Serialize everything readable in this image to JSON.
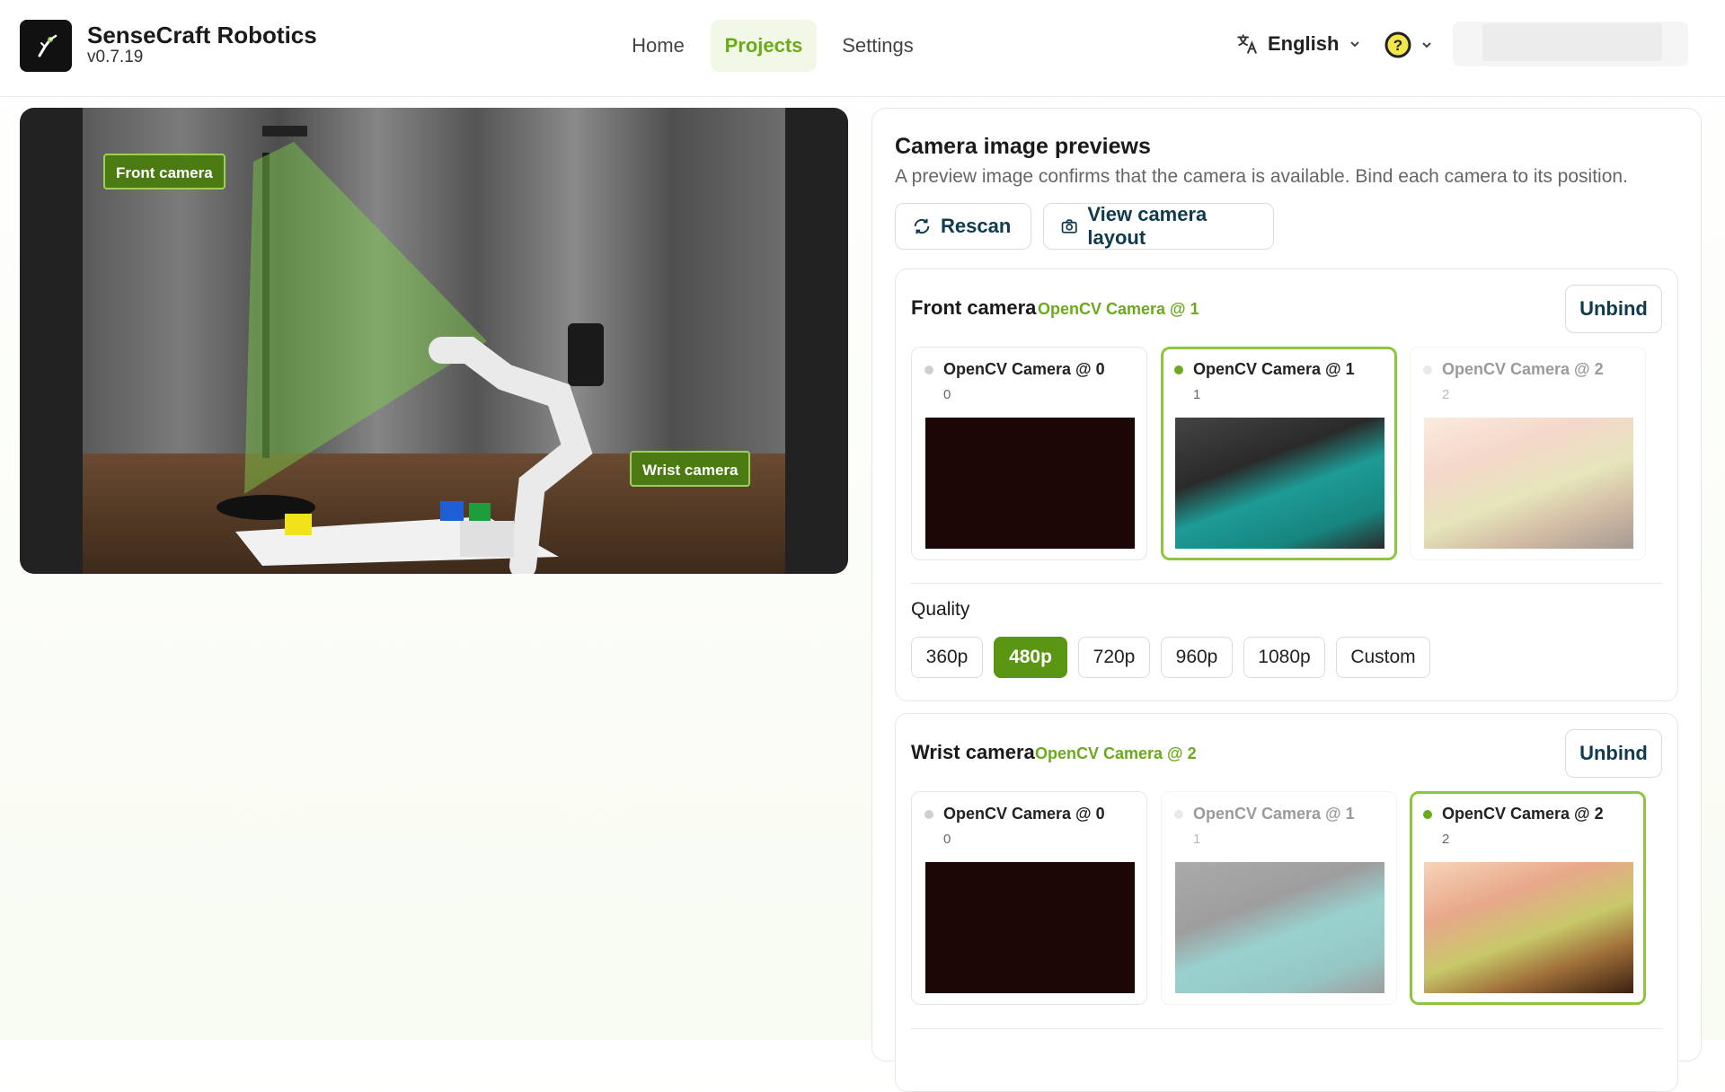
{
  "app": {
    "name": "SenseCraft Robotics",
    "version": "v0.7.19"
  },
  "nav": [
    {
      "label": "Home"
    },
    {
      "label": "Projects"
    },
    {
      "label": "Settings"
    }
  ],
  "language": {
    "label": "English"
  },
  "video": {
    "front_tag": "Front camera",
    "wrist_tag": "Wrist camera"
  },
  "panel": {
    "title": "Camera image previews",
    "subtitle": "A preview image confirms that the camera is available. Bind each camera to its position.",
    "rescan": "Rescan",
    "view_layout": "View camera layout"
  },
  "front": {
    "title": "Front camera",
    "bound": "OpenCV Camera @ 1",
    "unbind": "Unbind",
    "options": [
      {
        "name": "OpenCV Camera @ 0",
        "index": "0",
        "state": "available"
      },
      {
        "name": "OpenCV Camera @ 1",
        "index": "1",
        "state": "selected"
      },
      {
        "name": "OpenCV Camera @ 2",
        "index": "2",
        "state": "unavailable"
      }
    ],
    "quality_label": "Quality",
    "qualities": [
      "360p",
      "480p",
      "720p",
      "960p",
      "1080p",
      "Custom"
    ],
    "quality_selected": "480p"
  },
  "wrist": {
    "title": "Wrist camera",
    "bound": "OpenCV Camera @ 2",
    "unbind": "Unbind",
    "options": [
      {
        "name": "OpenCV Camera @ 0",
        "index": "0",
        "state": "available"
      },
      {
        "name": "OpenCV Camera @ 1",
        "index": "1",
        "state": "unavailable"
      },
      {
        "name": "OpenCV Camera @ 2",
        "index": "2",
        "state": "selected"
      }
    ]
  },
  "colors": {
    "accent": "#6aaa1b",
    "accent_dark": "#5a9613",
    "nav_active_bg": "#f1f8e5",
    "button_text": "#0f3b4d"
  }
}
